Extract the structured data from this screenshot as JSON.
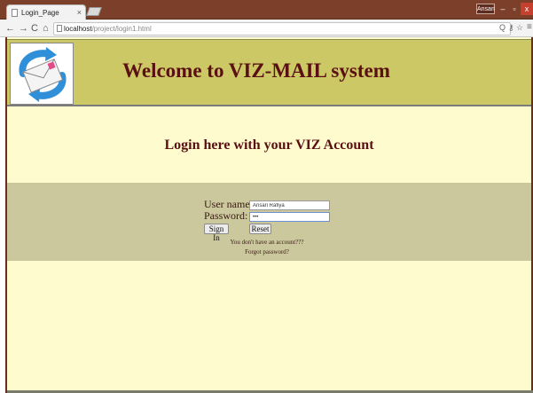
{
  "browser": {
    "tab_title": "Login_Page",
    "tab_close": "×",
    "user_badge": "Ansari",
    "window_minimize": "–",
    "window_maximize": "▫",
    "window_close": "x",
    "nav_back": "←",
    "nav_forward": "→",
    "nav_reload": "C",
    "nav_home": "⌂",
    "url_host": "localhost",
    "url_path": "/project/login1.html",
    "icons": [
      "search-icon",
      "key-icon",
      "star-icon",
      "menu-icon"
    ],
    "zoom_glyph": "Q",
    "key_glyph": "⚷",
    "star_glyph": "☆",
    "menu_glyph": "≡"
  },
  "header": {
    "title": "Welcome to VIZ-MAIL system",
    "background": "#cbc865",
    "title_color": "#5a1012",
    "logo_icon": "envelope-refresh-icon"
  },
  "page": {
    "subheading": "Login here with your VIZ Account",
    "background": "#fefbcf"
  },
  "login": {
    "username_label": "User name:",
    "username_value": "Ansari Rafiya",
    "password_label": "Password:",
    "password_value": "•••",
    "signin_label": "Sign In",
    "reset_label": "Reset",
    "register_link": "You don't have an account???",
    "forgot_link": "Forgot password?",
    "band_color": "#cbc89e"
  }
}
